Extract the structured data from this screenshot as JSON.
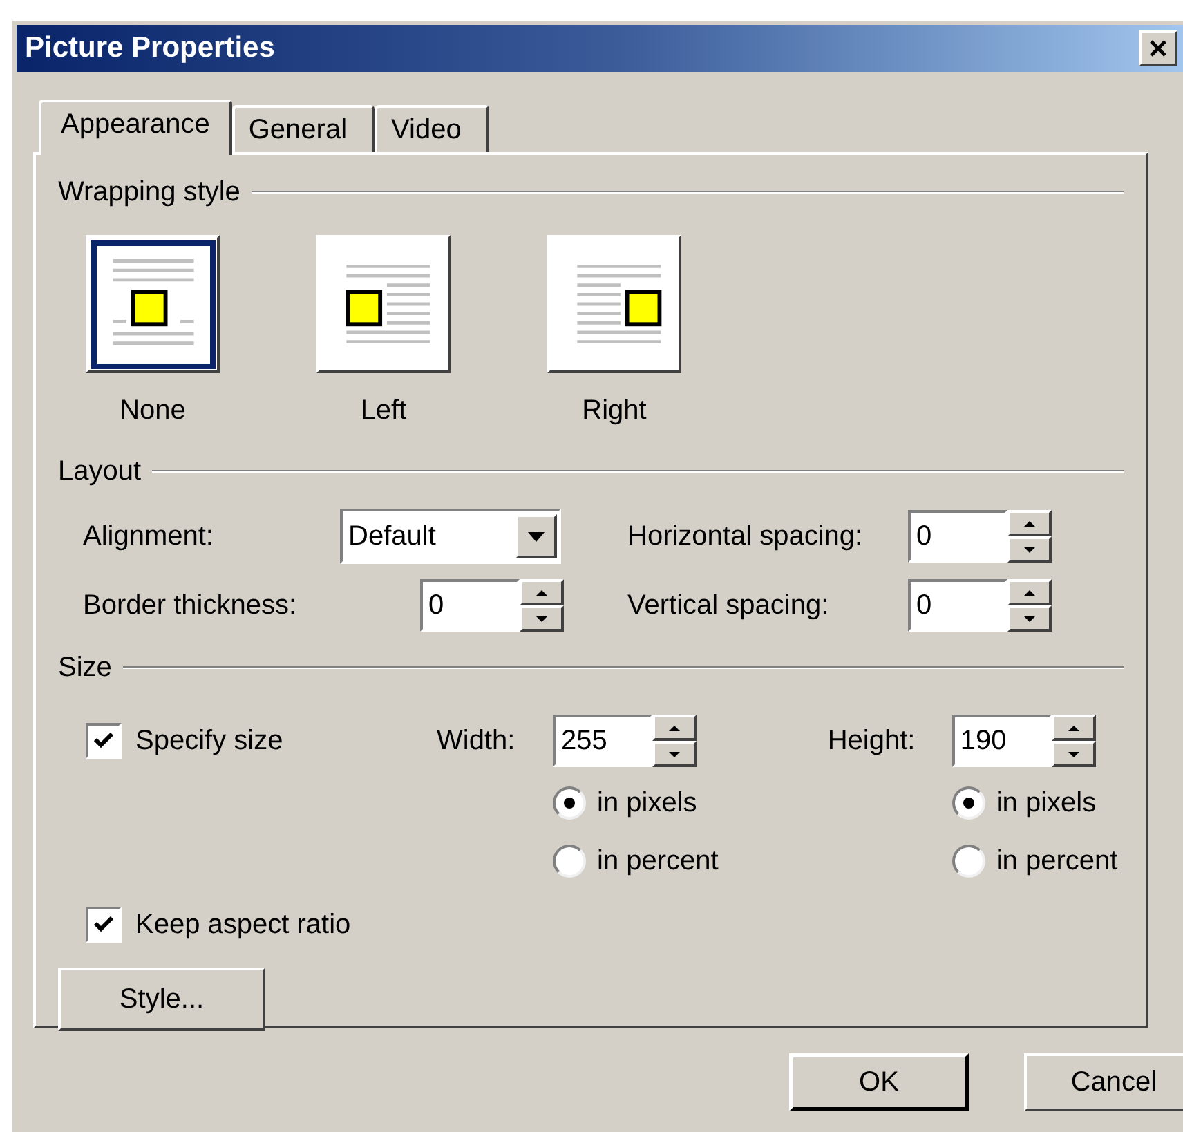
{
  "window": {
    "title": "Picture Properties"
  },
  "tabs": [
    {
      "label": "Appearance",
      "selected": true
    },
    {
      "label": "General",
      "selected": false
    },
    {
      "label": "Video",
      "selected": false
    }
  ],
  "wrapping_style": {
    "heading": "Wrapping style",
    "options": [
      {
        "label": "None",
        "kind": "none",
        "selected": true
      },
      {
        "label": "Left",
        "kind": "left",
        "selected": false
      },
      {
        "label": "Right",
        "kind": "right",
        "selected": false
      }
    ]
  },
  "layout": {
    "heading": "Layout",
    "alignment": {
      "label": "Alignment:",
      "value": "Default"
    },
    "border_thickness": {
      "label": "Border thickness:",
      "value": "0"
    },
    "horizontal_spacing": {
      "label": "Horizontal spacing:",
      "value": "0"
    },
    "vertical_spacing": {
      "label": "Vertical spacing:",
      "value": "0"
    }
  },
  "size": {
    "heading": "Size",
    "specify_size": {
      "label": "Specify size",
      "checked": true
    },
    "width": {
      "label": "Width:",
      "value": "255",
      "units": [
        {
          "label": "in pixels",
          "selected": true
        },
        {
          "label": "in percent",
          "selected": false
        }
      ]
    },
    "height": {
      "label": "Height:",
      "value": "190",
      "units": [
        {
          "label": "in pixels",
          "selected": true
        },
        {
          "label": "in percent",
          "selected": false
        }
      ]
    },
    "keep_aspect_ratio": {
      "label": "Keep aspect ratio",
      "checked": true
    },
    "style_button": "Style..."
  },
  "buttons": [
    "OK",
    "Cancel"
  ]
}
